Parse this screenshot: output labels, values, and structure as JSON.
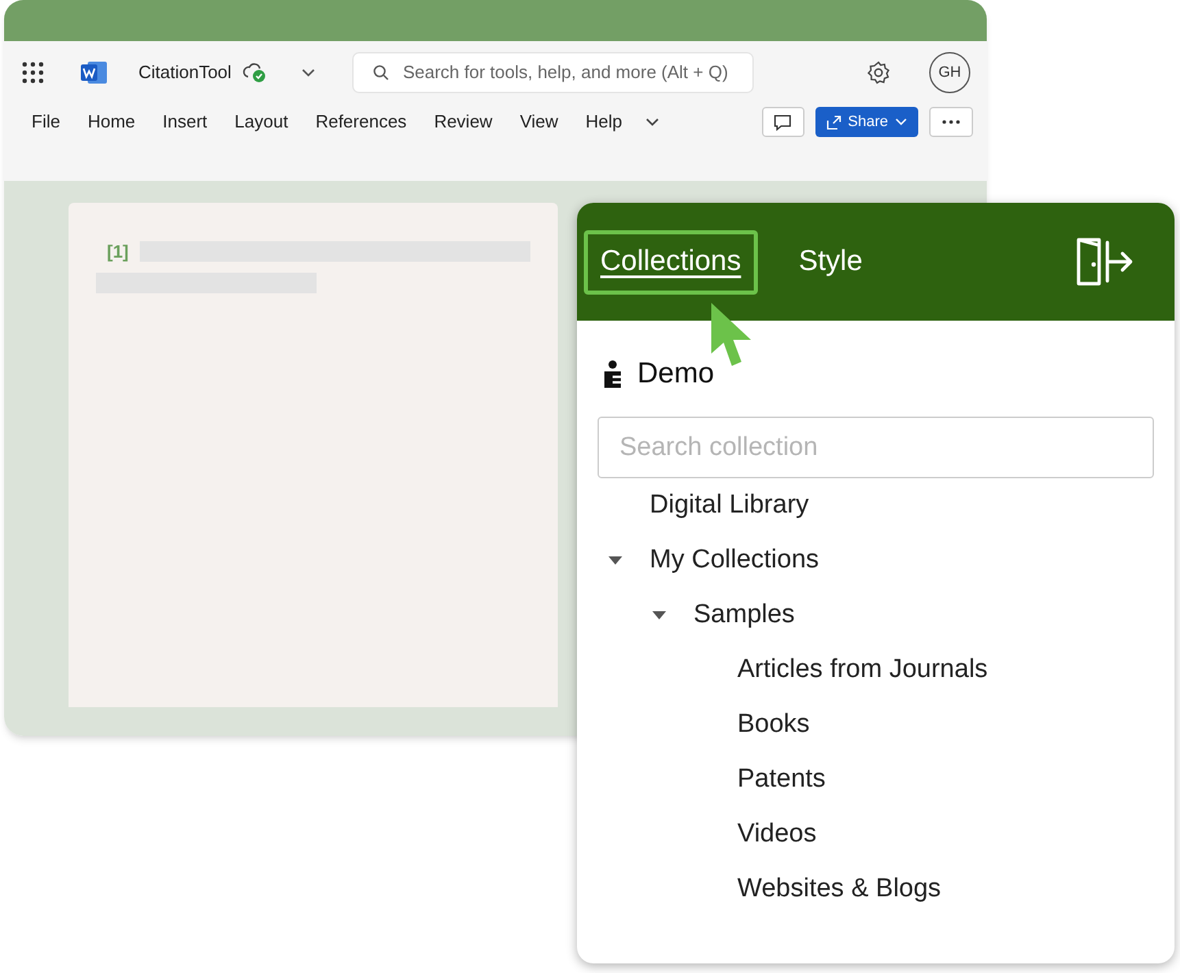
{
  "word": {
    "app_name": "CitationTool",
    "search": {
      "placeholder": "Search for tools, help, and more (Alt + Q)"
    },
    "avatar": "GH",
    "menu": [
      "File",
      "Home",
      "Insert",
      "Layout",
      "References",
      "Review",
      "View",
      "Help"
    ],
    "share_button": "Share",
    "document": {
      "citation_mark": "[1]"
    }
  },
  "panel": {
    "tabs": [
      {
        "label": "Collections",
        "selected": true
      },
      {
        "label": "Style",
        "selected": false
      }
    ],
    "user": "Demo",
    "search": {
      "placeholder": "Search collection"
    },
    "tree": [
      {
        "label": "Digital Library"
      },
      {
        "label": "My Collections",
        "expanded": true,
        "children": [
          {
            "label": "Samples",
            "expanded": true,
            "children": [
              {
                "label": "Articles from Journals"
              },
              {
                "label": "Books"
              },
              {
                "label": "Patents"
              },
              {
                "label": "Videos"
              },
              {
                "label": "Websites & Blogs"
              }
            ]
          }
        ]
      }
    ]
  }
}
